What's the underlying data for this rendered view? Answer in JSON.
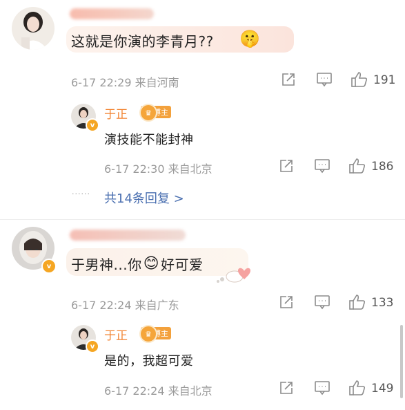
{
  "comments": [
    {
      "content": "这就是你演的李青月??",
      "emoji": "🤫",
      "timestamp": "6-17 22:29",
      "location": "来自河南",
      "likes": "191",
      "reply": {
        "author": "于正",
        "badge": "博主",
        "content": "演技能不能封神",
        "timestamp": "6-17 22:30",
        "location": "来自北京",
        "likes": "186"
      },
      "more_replies": "共14条回复 >"
    },
    {
      "content_before": "于男神...你",
      "emoji": "😊",
      "content_after": "好可爱",
      "timestamp": "6-17 22:24",
      "location": "来自广东",
      "likes": "133",
      "reply": {
        "author": "于正",
        "badge": "博主",
        "content": "是的，我超可爱",
        "timestamp": "6-17 22:24",
        "location": "来自北京",
        "likes": "149"
      }
    }
  ],
  "ellipsis": "······",
  "icons": {
    "share": "share-icon",
    "comment": "comment-icon",
    "like": "like-icon"
  },
  "colors": {
    "blogger_name": "#f2822f",
    "badge": "#f3a13c",
    "link": "#4a6fb0",
    "meta": "#9a9a9a"
  }
}
